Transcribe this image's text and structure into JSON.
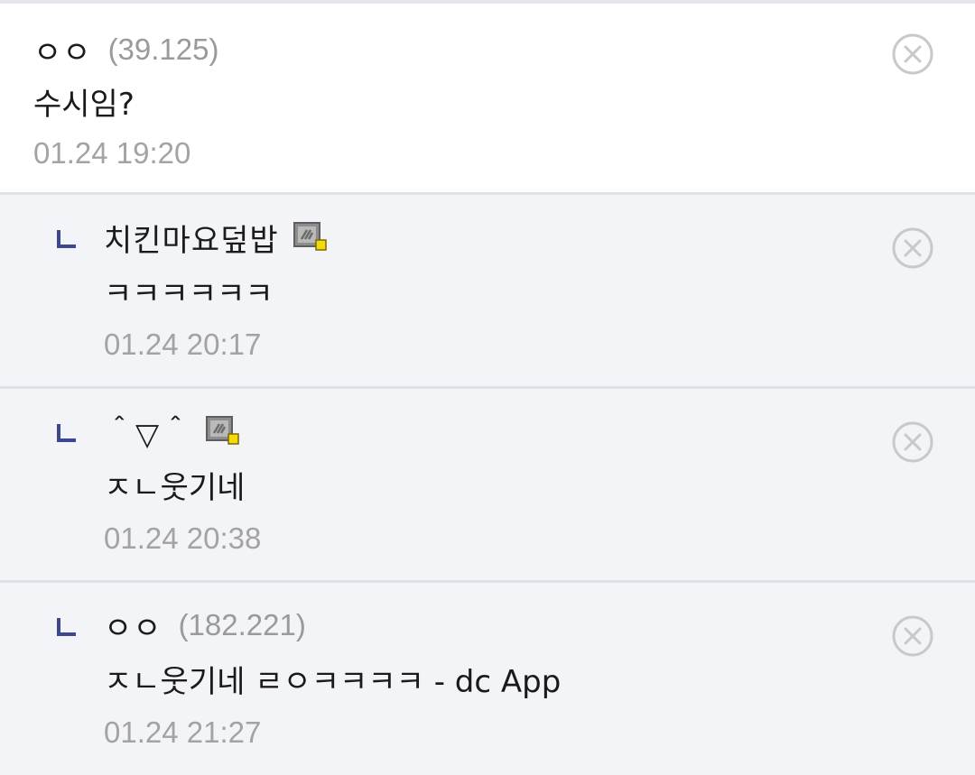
{
  "comments": [
    {
      "nick": "ㅇㅇ",
      "ip": "(39.125)",
      "text": "수시임?",
      "date": "01.24 19:20"
    },
    {
      "nick": "치킨마요덮밥",
      "icon": "fixed-nick-icon",
      "text": "ㅋㅋㅋㅋㅋㅋ",
      "date": "01.24 20:17"
    },
    {
      "nick": "＾▽＾",
      "icon": "fixed-nick-icon",
      "text": "ㅈㄴ웃기네",
      "date": "01.24 20:38"
    },
    {
      "nick": "ㅇㅇ",
      "ip": "(182.221)",
      "text": "ㅈㄴ웃기네 ㄹㅇㅋㅋㅋㅋ - dc App",
      "date": "01.24 21:27"
    }
  ],
  "icons": {
    "reply": "reply-arrow-icon",
    "delete": "delete-circle-x-icon"
  },
  "colors": {
    "reply_mark": "#3b4890",
    "divider": "#dfe1e8",
    "reply_bg": "#f3f4f8",
    "meta_text": "#a3a3a3"
  }
}
